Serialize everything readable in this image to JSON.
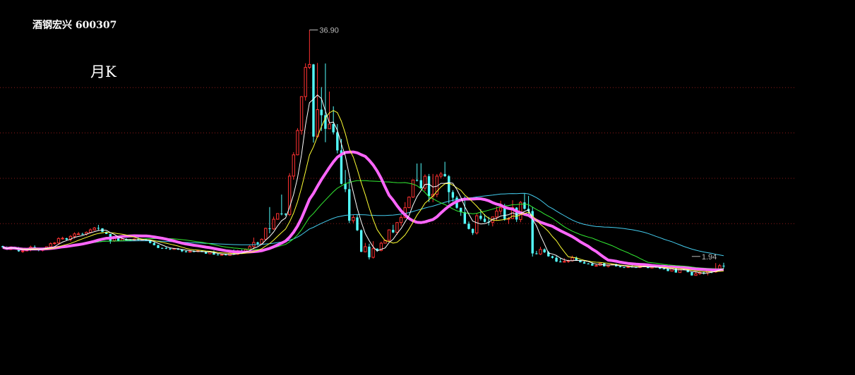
{
  "header": {
    "stock_name": "酒钢宏兴",
    "stock_code": "600307",
    "period_label": "月K"
  },
  "colors": {
    "up": "#ff3232",
    "down": "#54ffff",
    "grid": "#8b1a1a",
    "ma5": "#ffffff",
    "ma10": "#ffff33",
    "ma20": "#ff66ff",
    "ma30": "#33ee33",
    "ma60": "#44ccee"
  },
  "chart_data": {
    "type": "candlestick",
    "title": "酒钢宏兴 600307",
    "period": "月K",
    "ylim": [
      -2,
      40
    ],
    "grid": true,
    "annotations": [
      {
        "label": "36.90",
        "value": 36.9,
        "type": "high"
      },
      {
        "label": "1.94",
        "value": 1.94,
        "type": "low"
      }
    ],
    "ohlc": [
      [
        3.54,
        3.61,
        3.31,
        3.33
      ],
      [
        3.33,
        3.48,
        3.0,
        3.01
      ],
      [
        3.01,
        3.49,
        2.92,
        3.4
      ],
      [
        3.4,
        3.46,
        3.06,
        3.17
      ],
      [
        3.17,
        3.4,
        2.66,
        2.73
      ],
      [
        2.73,
        2.98,
        2.49,
        2.79
      ],
      [
        2.79,
        3.0,
        2.74,
        2.94
      ],
      [
        2.94,
        3.6,
        2.74,
        3.39
      ],
      [
        3.39,
        3.65,
        2.95,
        3.2
      ],
      [
        3.2,
        3.24,
        2.74,
        2.88
      ],
      [
        2.88,
        3.26,
        2.71,
        3.06
      ],
      [
        3.06,
        3.51,
        2.92,
        3.43
      ],
      [
        3.43,
        4.1,
        3.04,
        3.91
      ],
      [
        3.91,
        4.16,
        3.77,
        4.02
      ],
      [
        4.02,
        4.91,
        3.8,
        4.7
      ],
      [
        4.7,
        4.98,
        4.54,
        4.75
      ],
      [
        4.75,
        4.83,
        4.4,
        4.54
      ],
      [
        4.54,
        5.24,
        4.26,
        5.04
      ],
      [
        5.04,
        5.65,
        4.69,
        5.42
      ],
      [
        5.42,
        5.72,
        5.34,
        5.42
      ],
      [
        5.42,
        5.59,
        5.27,
        5.38
      ],
      [
        5.38,
        5.79,
        5.16,
        5.67
      ],
      [
        5.67,
        6.27,
        5.59,
        6.04
      ],
      [
        6.04,
        6.48,
        5.92,
        6.34
      ],
      [
        6.34,
        6.81,
        5.96,
        6.28
      ],
      [
        6.28,
        6.3,
        5.7,
        5.73
      ],
      [
        5.73,
        5.79,
        5.39,
        5.41
      ],
      [
        5.41,
        5.42,
        3.9,
        4.37
      ],
      [
        4.37,
        5.01,
        4.19,
        4.86
      ],
      [
        4.86,
        4.91,
        4.25,
        4.35
      ],
      [
        4.35,
        4.75,
        4.31,
        4.63
      ],
      [
        4.63,
        4.75,
        4.37,
        4.46
      ],
      [
        4.46,
        4.59,
        4.37,
        4.45
      ],
      [
        4.45,
        4.74,
        4.39,
        4.62
      ],
      [
        4.62,
        4.89,
        4.38,
        4.52
      ],
      [
        4.52,
        4.56,
        4.42,
        4.54
      ],
      [
        4.54,
        4.64,
        4.34,
        4.39
      ],
      [
        4.39,
        4.45,
        3.95,
        4.02
      ],
      [
        4.02,
        4.17,
        3.65,
        3.67
      ],
      [
        3.67,
        3.76,
        3.24,
        3.25
      ],
      [
        3.25,
        3.3,
        3.1,
        3.24
      ],
      [
        3.24,
        3.45,
        3.07,
        3.15
      ],
      [
        3.15,
        3.23,
        2.94,
        3.03
      ],
      [
        3.03,
        3.27,
        3.0,
        3.16
      ],
      [
        3.16,
        3.24,
        2.93,
        3.0
      ],
      [
        3.0,
        3.06,
        2.61,
        2.73
      ],
      [
        2.73,
        2.83,
        2.56,
        2.59
      ],
      [
        2.59,
        2.92,
        2.56,
        2.72
      ],
      [
        2.72,
        2.87,
        2.66,
        2.7
      ],
      [
        2.7,
        2.89,
        2.59,
        2.82
      ],
      [
        2.82,
        2.9,
        2.61,
        2.64
      ],
      [
        2.64,
        2.7,
        2.35,
        2.36
      ],
      [
        2.36,
        2.67,
        2.28,
        2.64
      ],
      [
        2.64,
        2.84,
        2.21,
        2.22
      ],
      [
        2.22,
        2.32,
        2.15,
        2.15
      ],
      [
        2.15,
        2.28,
        2.09,
        2.23
      ],
      [
        2.23,
        2.35,
        2.11,
        2.11
      ],
      [
        2.11,
        2.54,
        2.1,
        2.44
      ],
      [
        2.44,
        3.01,
        2.2,
        2.28
      ],
      [
        2.28,
        2.98,
        2.17,
        2.79
      ],
      [
        2.79,
        3.0,
        2.52,
        2.68
      ],
      [
        2.68,
        3.17,
        2.57,
        3.01
      ],
      [
        3.01,
        3.67,
        2.93,
        3.46
      ],
      [
        3.46,
        4.85,
        3.01,
        4.1
      ],
      [
        4.1,
        4.22,
        3.59,
        3.9
      ],
      [
        3.9,
        4.72,
        3.77,
        4.59
      ],
      [
        4.59,
        6.38,
        4.44,
        6.28
      ],
      [
        6.28,
        9.56,
        5.51,
        6.19
      ],
      [
        6.19,
        8.09,
        6.05,
        7.68
      ],
      [
        7.68,
        8.57,
        7.61,
        8.56
      ],
      [
        8.56,
        11.49,
        8.28,
        8.54
      ],
      [
        8.54,
        8.6,
        8.22,
        8.4
      ],
      [
        8.4,
        14.79,
        8.17,
        14.34
      ],
      [
        14.34,
        18.02,
        13.78,
        17.62
      ],
      [
        17.62,
        21.74,
        17.55,
        21.38
      ],
      [
        21.38,
        26.69,
        20.74,
        26.61
      ],
      [
        26.61,
        31.76,
        26.0,
        31.12
      ],
      [
        31.12,
        36.9,
        30.87,
        31.58
      ],
      [
        31.58,
        31.66,
        19.51,
        20.44
      ],
      [
        20.44,
        31.81,
        20.25,
        24.6
      ],
      [
        24.6,
        28.08,
        21.31,
        23.74
      ],
      [
        23.74,
        31.72,
        19.57,
        21.64
      ],
      [
        21.64,
        27.39,
        21.63,
        22.37
      ],
      [
        22.37,
        25.11,
        20.77,
        21.1
      ],
      [
        21.1,
        22.38,
        17.85,
        18.31
      ],
      [
        18.31,
        20.08,
        13.06,
        13.15
      ],
      [
        13.15,
        15.28,
        11.87,
        12.32
      ],
      [
        12.32,
        13.86,
        7.09,
        7.46
      ],
      [
        7.46,
        8.35,
        7.1,
        7.96
      ],
      [
        7.96,
        8.44,
        5.86,
        5.98
      ],
      [
        5.98,
        6.11,
        2.61,
        2.65
      ],
      [
        2.65,
        4.03,
        2.58,
        3.45
      ],
      [
        3.45,
        3.91,
        1.47,
        1.8
      ],
      [
        1.8,
        4.29,
        1.62,
        3.14
      ],
      [
        3.14,
        3.19,
        2.65,
        2.87
      ],
      [
        2.87,
        4.21,
        2.73,
        3.98
      ],
      [
        3.98,
        4.5,
        3.93,
        4.43
      ],
      [
        4.43,
        6.11,
        4.24,
        6.04
      ],
      [
        6.04,
        6.83,
        5.53,
        5.65
      ],
      [
        5.65,
        7.22,
        5.29,
        7.17
      ],
      [
        7.17,
        8.32,
        6.63,
        7.95
      ],
      [
        7.95,
        10.32,
        7.8,
        9.47
      ],
      [
        9.47,
        11.2,
        9.39,
        11.1
      ],
      [
        11.1,
        13.81,
        10.97,
        13.74
      ],
      [
        13.74,
        16.28,
        13.51,
        13.7
      ],
      [
        13.7,
        16.33,
        13.21,
        12.47
      ],
      [
        12.47,
        14.61,
        12.02,
        14.31
      ],
      [
        14.31,
        14.67,
        10.33,
        11.27
      ],
      [
        11.27,
        14.67,
        10.33,
        11.54
      ],
      [
        11.54,
        14.66,
        11.09,
        14.33
      ],
      [
        14.33,
        14.97,
        13.99,
        14.66
      ],
      [
        14.66,
        16.55,
        14.23,
        14.31
      ],
      [
        14.31,
        14.51,
        10.1,
        11.87
      ],
      [
        11.87,
        12.17,
        10.42,
        11.01
      ],
      [
        11.01,
        11.29,
        9.28,
        9.45
      ],
      [
        9.45,
        9.45,
        8.2,
        8.76
      ],
      [
        8.76,
        11.22,
        6.97,
        6.98
      ],
      [
        6.98,
        7.33,
        6.1,
        6.19
      ],
      [
        6.19,
        6.24,
        5.25,
        5.56
      ],
      [
        5.56,
        8.56,
        5.32,
        8.22
      ],
      [
        8.22,
        9.22,
        7.49,
        7.75
      ],
      [
        7.75,
        8.46,
        7.19,
        7.28
      ],
      [
        7.28,
        8.05,
        6.73,
        7.21
      ],
      [
        7.21,
        8.04,
        6.58,
        8.04
      ],
      [
        8.04,
        9.62,
        7.46,
        8.95
      ],
      [
        8.95,
        10.54,
        8.39,
        9.44
      ],
      [
        9.44,
        10.06,
        7.45,
        7.71
      ],
      [
        7.71,
        8.02,
        6.95,
        7.78
      ],
      [
        7.78,
        10.62,
        7.74,
        9.47
      ],
      [
        9.47,
        9.55,
        7.27,
        7.64
      ],
      [
        7.64,
        10.51,
        7.22,
        10.28
      ],
      [
        10.28,
        11.67,
        9.17,
        9.3
      ],
      [
        9.3,
        11.29,
        8.15,
        8.93
      ],
      [
        8.93,
        9.62,
        1.92,
        2.41
      ],
      [
        2.41,
        2.8,
        2.24,
        2.31
      ],
      [
        2.31,
        3.43,
        2.17,
        3.03
      ],
      [
        3.03,
        3.18,
        2.48,
        2.58
      ],
      [
        2.58,
        2.79,
        1.89,
        1.96
      ],
      [
        1.96,
        2.07,
        1.61,
        1.73
      ],
      [
        1.73,
        1.99,
        1.07,
        1.15
      ],
      [
        1.15,
        1.66,
        1.03,
        1.1
      ],
      [
        1.1,
        1.67,
        1.0,
        1.17
      ],
      [
        1.17,
        1.43,
        0.94,
        1.27
      ],
      [
        1.27,
        2.07,
        1.14,
        1.75
      ],
      [
        1.75,
        1.93,
        1.29,
        1.38
      ],
      [
        1.38,
        1.4,
        1.02,
        1.04
      ],
      [
        1.04,
        1.29,
        0.81,
        0.84
      ],
      [
        0.84,
        0.92,
        0.76,
        0.81
      ],
      [
        0.81,
        1.04,
        0.51,
        0.52
      ],
      [
        0.52,
        0.69,
        0.51,
        0.54
      ],
      [
        0.54,
        0.9,
        0.5,
        0.88
      ],
      [
        0.88,
        0.95,
        0.4,
        0.4
      ],
      [
        0.4,
        0.68,
        0.25,
        0.65
      ],
      [
        0.65,
        0.77,
        0.57,
        0.77
      ],
      [
        0.77,
        0.82,
        0.4,
        0.41
      ],
      [
        0.41,
        0.46,
        0.26,
        0.28
      ],
      [
        0.28,
        0.31,
        0.15,
        0.25
      ],
      [
        0.25,
        0.37,
        0.15,
        0.34
      ],
      [
        0.34,
        0.64,
        0.26,
        0.27
      ],
      [
        0.27,
        0.36,
        0.18,
        0.23
      ],
      [
        0.23,
        0.55,
        0.14,
        0.48
      ],
      [
        0.48,
        0.65,
        0.42,
        0.44
      ],
      [
        0.44,
        0.63,
        0.14,
        0.15
      ],
      [
        0.15,
        0.34,
        0.15,
        0.32
      ],
      [
        0.32,
        0.66,
        0.21,
        0.22
      ],
      [
        0.22,
        0.28,
        0.0,
        0.05
      ],
      [
        0.05,
        0.47,
        0.0,
        0.0
      ],
      [
        0.0,
        0.0,
        -0.33,
        -0.32
      ],
      [
        -0.32,
        0.19,
        -0.32,
        0.18
      ],
      [
        0.18,
        0.2,
        -0.55,
        -0.55
      ],
      [
        -0.55,
        0.12,
        -0.58,
        0.09
      ],
      [
        0.09,
        0.37,
        -0.14,
        -0.12
      ],
      [
        -0.12,
        -0.05,
        -0.5,
        -0.49
      ],
      [
        -0.49,
        -0.48,
        -1.03,
        -0.99
      ],
      [
        -0.99,
        -0.46,
        -0.99,
        -0.72
      ],
      [
        -0.72,
        -0.3,
        -0.93,
        -0.54
      ],
      [
        -0.54,
        -0.44,
        -0.85,
        -0.57
      ],
      [
        -0.57,
        -0.23,
        -0.98,
        -0.23
      ],
      [
        -0.23,
        0.06,
        -0.66,
        -0.46
      ],
      [
        -0.46,
        0.92,
        -0.59,
        -0.01
      ],
      [
        -0.01,
        0.77,
        -0.26,
        0.51
      ],
      [
        0.51,
        0.96,
        0.09,
        0.46
      ]
    ]
  }
}
